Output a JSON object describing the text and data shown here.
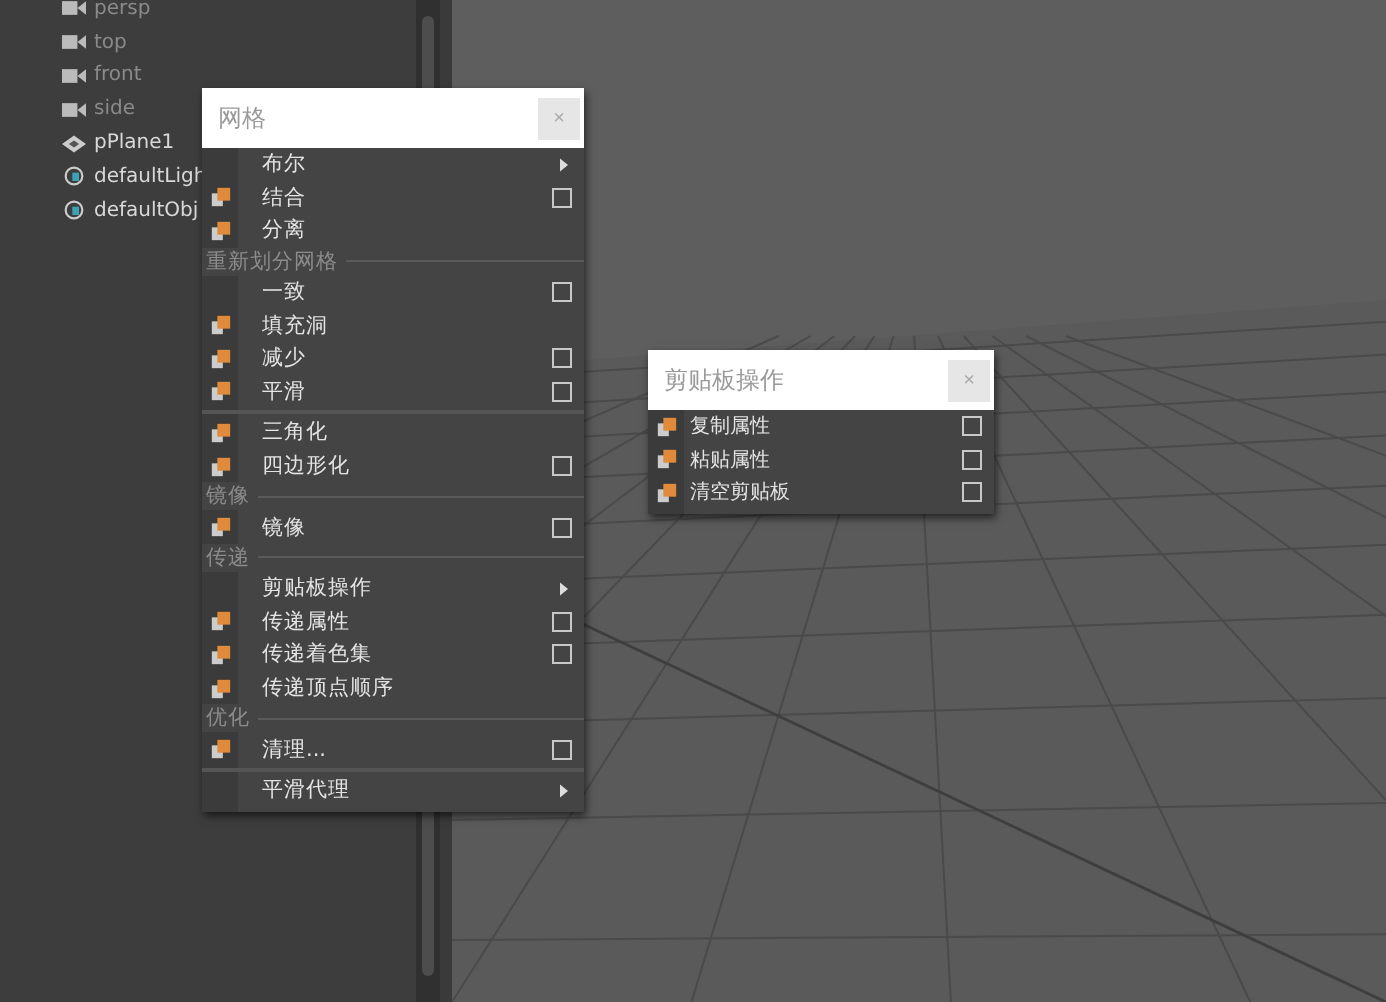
{
  "outliner": {
    "items": [
      {
        "label": "persp",
        "kind": "camera",
        "dimmed": true
      },
      {
        "label": "top",
        "kind": "camera",
        "dimmed": true
      },
      {
        "label": "front",
        "kind": "camera",
        "dimmed": true
      },
      {
        "label": "side",
        "kind": "camera",
        "dimmed": true
      },
      {
        "label": "pPlane1",
        "kind": "mesh",
        "dimmed": false
      },
      {
        "label": "defaultLigh",
        "kind": "set",
        "dimmed": false
      },
      {
        "label": "defaultObj",
        "kind": "set",
        "dimmed": false
      }
    ]
  },
  "mesh_menu": {
    "title": "网格",
    "close": "×",
    "items": [
      {
        "kind": "item",
        "label": "布尔",
        "icon": false,
        "option_box": false,
        "submenu": true
      },
      {
        "kind": "item",
        "label": "结合",
        "icon": true,
        "option_box": true,
        "submenu": false
      },
      {
        "kind": "item",
        "label": "分离",
        "icon": true,
        "option_box": false,
        "submenu": false
      },
      {
        "kind": "section",
        "label": "重新划分网格"
      },
      {
        "kind": "item",
        "label": "一致",
        "icon": false,
        "option_box": true,
        "submenu": false
      },
      {
        "kind": "item",
        "label": "填充洞",
        "icon": true,
        "option_box": false,
        "submenu": false
      },
      {
        "kind": "item",
        "label": "减少",
        "icon": true,
        "option_box": true,
        "submenu": false
      },
      {
        "kind": "item",
        "label": "平滑",
        "icon": true,
        "option_box": true,
        "submenu": false
      },
      {
        "kind": "separator"
      },
      {
        "kind": "item",
        "label": "三角化",
        "icon": true,
        "option_box": false,
        "submenu": false
      },
      {
        "kind": "item",
        "label": "四边形化",
        "icon": true,
        "option_box": true,
        "submenu": false
      },
      {
        "kind": "section",
        "label": "镜像"
      },
      {
        "kind": "item",
        "label": "镜像",
        "icon": true,
        "option_box": true,
        "submenu": false
      },
      {
        "kind": "section",
        "label": "传递"
      },
      {
        "kind": "item",
        "label": "剪贴板操作",
        "icon": false,
        "option_box": false,
        "submenu": true
      },
      {
        "kind": "item",
        "label": "传递属性",
        "icon": true,
        "option_box": true,
        "submenu": false
      },
      {
        "kind": "item",
        "label": "传递着色集",
        "icon": true,
        "option_box": true,
        "submenu": false
      },
      {
        "kind": "item",
        "label": "传递顶点顺序",
        "icon": true,
        "option_box": false,
        "submenu": false
      },
      {
        "kind": "section",
        "label": "优化"
      },
      {
        "kind": "item",
        "label": "清理...",
        "icon": true,
        "option_box": true,
        "submenu": false
      },
      {
        "kind": "separator"
      },
      {
        "kind": "item",
        "label": "平滑代理",
        "icon": false,
        "option_box": false,
        "submenu": true
      }
    ]
  },
  "clipboard_menu": {
    "title": "剪贴板操作",
    "close": "×",
    "items": [
      {
        "kind": "item",
        "label": "复制属性",
        "icon": true,
        "option_box": true,
        "submenu": false
      },
      {
        "kind": "item",
        "label": "粘贴属性",
        "icon": true,
        "option_box": true,
        "submenu": false
      },
      {
        "kind": "item",
        "label": "清空剪贴板",
        "icon": true,
        "option_box": true,
        "submenu": false
      }
    ]
  }
}
